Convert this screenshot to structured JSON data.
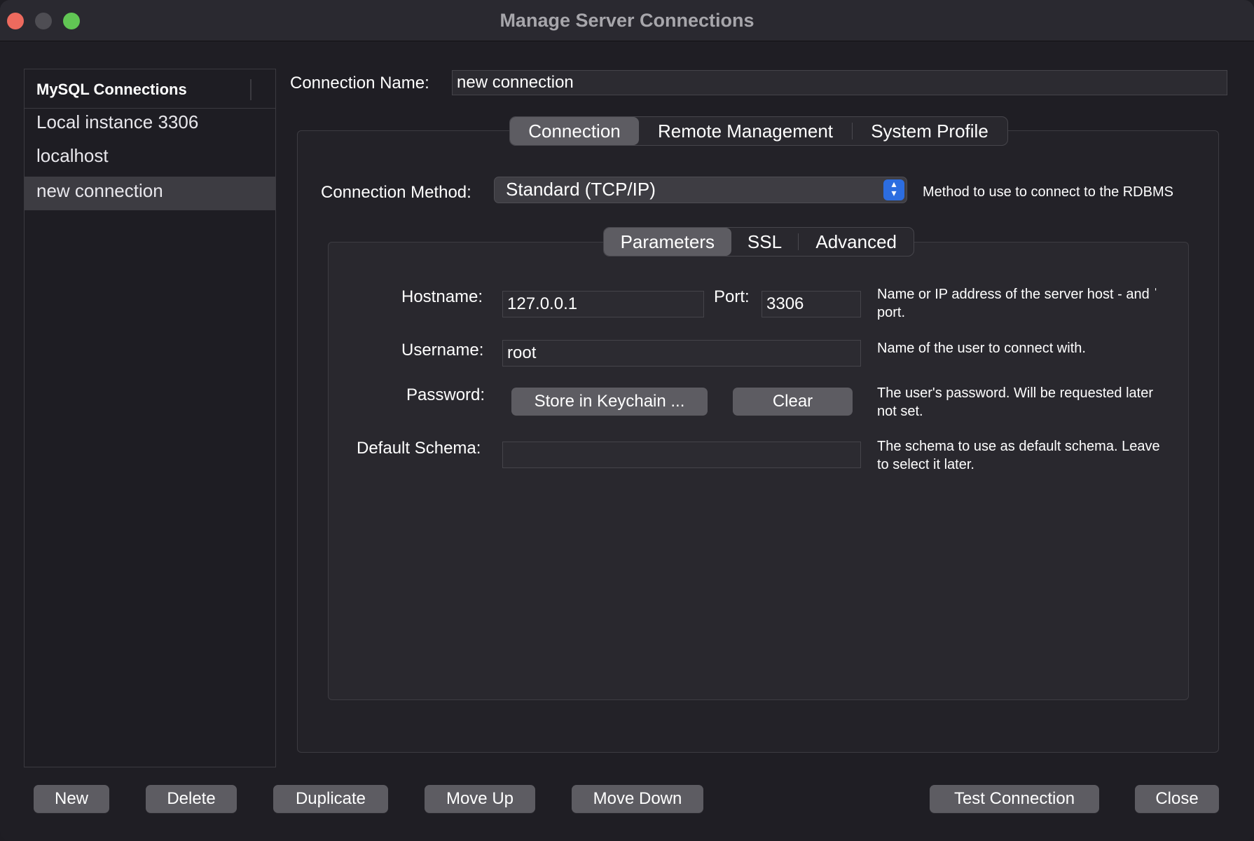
{
  "window": {
    "title": "Manage Server Connections"
  },
  "sidebar": {
    "header": "MySQL Connections",
    "items": [
      {
        "label": "Local instance 3306",
        "selected": false
      },
      {
        "label": "localhost",
        "selected": false
      },
      {
        "label": "new connection",
        "selected": true
      }
    ]
  },
  "connection_name": {
    "label": "Connection Name:",
    "value": "new connection"
  },
  "tabs": [
    "Connection",
    "Remote Management",
    "System Profile"
  ],
  "active_tab": "Connection",
  "connection_method": {
    "label": "Connection Method:",
    "value": "Standard (TCP/IP)",
    "help": "Method to use to connect to the RDBMS"
  },
  "subtabs": [
    "Parameters",
    "SSL",
    "Advanced"
  ],
  "active_subtab": "Parameters",
  "parameters": {
    "hostname": {
      "label": "Hostname:",
      "value": "127.0.0.1"
    },
    "port": {
      "label": "Port:",
      "value": "3306"
    },
    "hostname_help_1": "Name or IP address of the server host - and ˈ",
    "hostname_help_2": "port.",
    "username": {
      "label": "Username:",
      "value": "root",
      "help": "Name of the user to connect with."
    },
    "password": {
      "label": "Password:",
      "store_button": "Store in Keychain ...",
      "clear_button": "Clear",
      "help_1": "The user's password. Will be requested later",
      "help_2": "not set."
    },
    "default_schema": {
      "label": "Default Schema:",
      "value": "",
      "help_1": "The schema to use as default schema. Leave",
      "help_2": "to select it later."
    }
  },
  "footer": {
    "new": "New",
    "delete": "Delete",
    "duplicate": "Duplicate",
    "move_up": "Move Up",
    "move_down": "Move Down",
    "test_connection": "Test Connection",
    "close": "Close"
  },
  "colors": {
    "background": "#1f1e24",
    "select_arrow": "#2c6de0",
    "traffic_red": "#ed6a5e",
    "traffic_green": "#61c554"
  }
}
